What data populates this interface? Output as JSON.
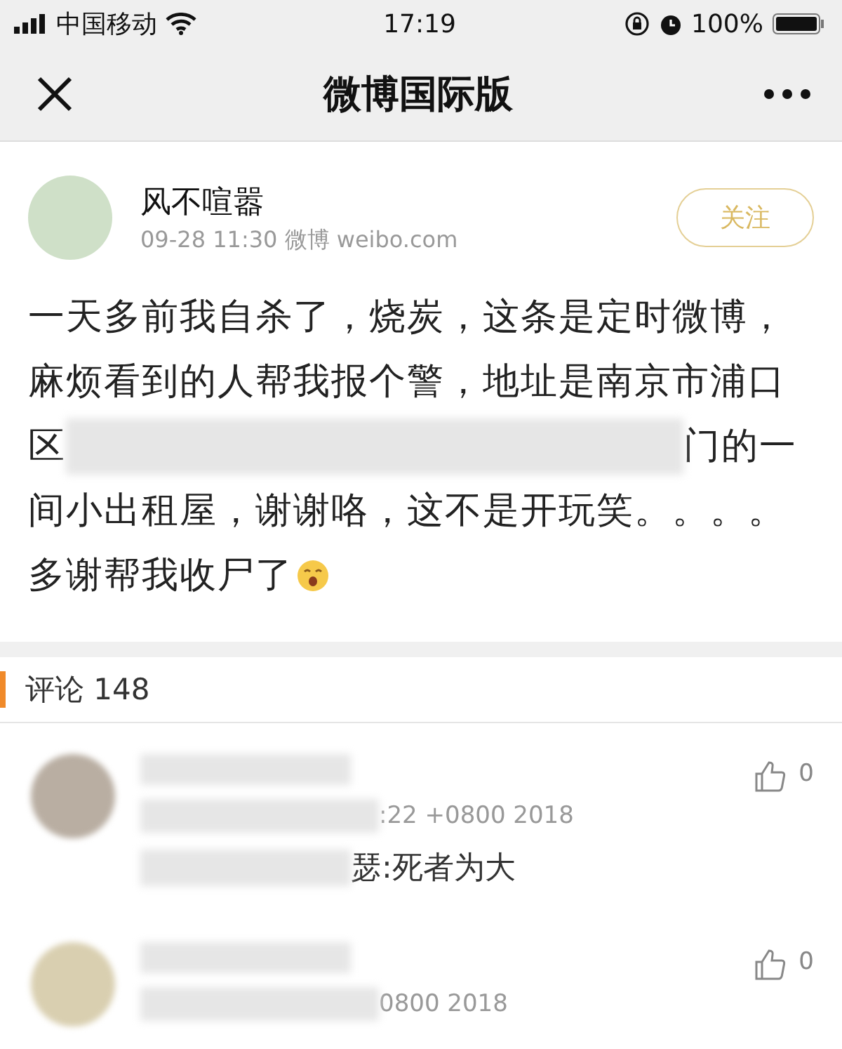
{
  "status_bar": {
    "carrier": "中国移动",
    "time": "17:19",
    "battery": "100%"
  },
  "nav": {
    "title": "微博国际版"
  },
  "post": {
    "author": "风不喧嚣",
    "meta": "09-28 11:30 微博 weibo.com",
    "follow_label": "关注",
    "lines": [
      {
        "kind": "text",
        "text": "一天多前我自杀了，烧炭，这条是定时微博，"
      },
      {
        "kind": "text",
        "text": "麻烦看到的人帮我报个警，地址是南京市浦口"
      },
      {
        "kind": "redacted",
        "before": "区",
        "after": "门的一"
      },
      {
        "kind": "text",
        "text": "间小出租屋，谢谢咯，这不是开玩笑。。。。"
      },
      {
        "kind": "emoji",
        "text": "多谢帮我收尸了"
      }
    ]
  },
  "comments_header": {
    "label": "评论 148"
  },
  "comments": [
    {
      "time": ":22 +0800 2018",
      "text": "瑟:死者为大",
      "likes": "0"
    },
    {
      "time": "0800 2018",
      "likes": "0"
    }
  ]
}
